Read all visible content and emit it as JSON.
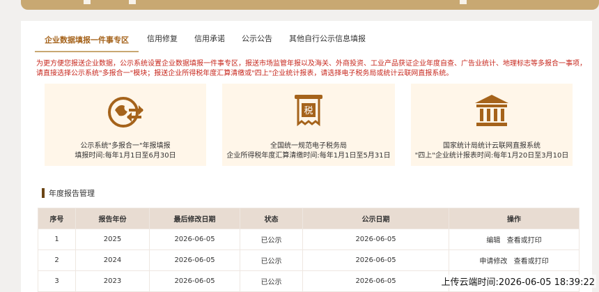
{
  "tabs": [
    {
      "label": "企业数据填报一件事专区",
      "active": true
    },
    {
      "label": "信用修复"
    },
    {
      "label": "信用承诺"
    },
    {
      "label": "公示公告"
    },
    {
      "label": "其他自行公示信息填报"
    }
  ],
  "notice": "为更方便您报送企业数据，公示系统设置企业数据填报一件事专区，报送市场监管年报以及海关、外商投资、工业产品获证企业年度自查、广告业统计、地理标志等多报合一事项，请直接选择公示系统\"多报合一\"模块；报送企业所得税年度汇算清缴或\"四上\"企业统计报表，请选择电子税务局或统计云联网直报系统。",
  "cards": [
    {
      "icon": "report-exchange-icon",
      "line1": "公示系统\"多报合一\"年报填报",
      "line2": "填报时间:每年1月1日至6月30日"
    },
    {
      "icon": "tax-icon",
      "line1": "全国统一规范电子税务局",
      "line2": "企业所得税年度汇算清缴时间:每年1月1日至5月31日"
    },
    {
      "icon": "government-building-icon",
      "line1": "国家统计局统计云联网直报系统",
      "line2": "\"四上\"企业统计报表时间:每年1月20日至3月10日"
    }
  ],
  "section": {
    "title": "年度报告管理"
  },
  "table": {
    "headers": [
      "序号",
      "报告年份",
      "最后修改日期",
      "状态",
      "公示日期",
      "操作"
    ],
    "rows": [
      {
        "no": "1",
        "year": "2025",
        "modified": "2026-06-05",
        "status": "已公示",
        "published": "2026-06-05",
        "op1": "编辑",
        "op2": "查看或打印"
      },
      {
        "no": "2",
        "year": "2024",
        "modified": "2026-06-05",
        "status": "已公示",
        "published": "2026-06-05",
        "op1": "申请修改",
        "op2": "查看或打印"
      },
      {
        "no": "3",
        "year": "2023",
        "modified": "2026-06-05",
        "status": "已公示",
        "published": "2026-06-05",
        "op1": "",
        "op2": ""
      }
    ]
  },
  "watermark": "上传云端时间:2026-06-05 18:39:22",
  "colors": {
    "accent": "#c8a872",
    "notice": "#c7271d",
    "card_bg": "#fff6e9",
    "icon": "#a5631b"
  }
}
